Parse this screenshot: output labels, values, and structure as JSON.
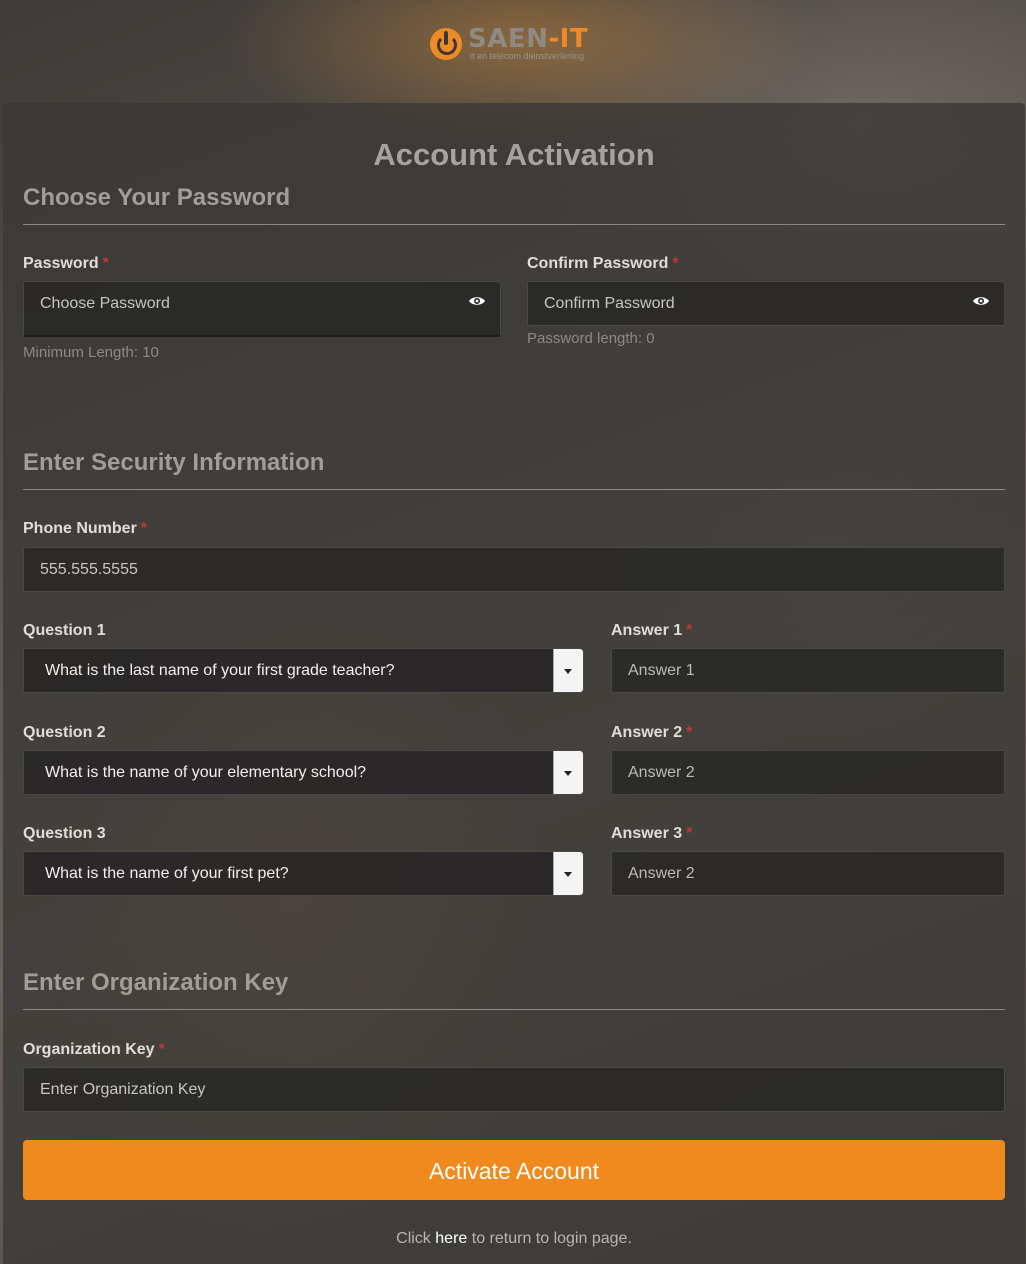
{
  "brand": {
    "name_part1": "SAEN",
    "name_part2": "-IT",
    "tagline": "it en telecom dienstverlening",
    "accent_color": "#f08a24"
  },
  "page": {
    "title": "Account Activation"
  },
  "password_section": {
    "heading": "Choose Your Password",
    "password_label": "Password",
    "password_placeholder": "Choose Password",
    "password_hint": "Minimum Length: 10",
    "confirm_label": "Confirm Password",
    "confirm_placeholder": "Confirm Password",
    "confirm_hint": "Password length: 0",
    "toggle_icon": "eye-icon"
  },
  "security_section": {
    "heading": "Enter Security Information",
    "phone_label": "Phone Number",
    "phone_placeholder": "555.555.5555",
    "questions": [
      {
        "label": "Question 1",
        "value": "What is the last name of your first grade teacher?",
        "answer_label": "Answer 1",
        "answer_placeholder": "Answer 1"
      },
      {
        "label": "Question 2",
        "value": "What is the name of your elementary school?",
        "answer_label": "Answer 2",
        "answer_placeholder": "Answer 2"
      },
      {
        "label": "Question 3",
        "value": "What is the name of your first pet?",
        "answer_label": "Answer 3",
        "answer_placeholder": "Answer 2"
      }
    ]
  },
  "org_section": {
    "heading": "Enter Organization Key",
    "key_label": "Organization Key",
    "key_placeholder": "Enter Organization Key"
  },
  "required_marker": "*",
  "actions": {
    "activate_label": "Activate Account"
  },
  "footer": {
    "prefix": "Click",
    "link": "here",
    "suffix": "to return to login page."
  }
}
